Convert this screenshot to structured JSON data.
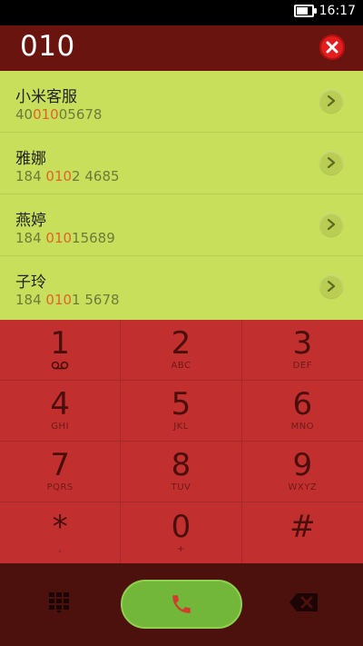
{
  "status_bar": {
    "time": "16:17",
    "battery_level": 0.85,
    "battery_icon": "battery-icon"
  },
  "header": {
    "number": "010",
    "clear_icon": "close-icon",
    "colors": {
      "bg": "#6a1410",
      "clear": "#e21e1e"
    }
  },
  "results": [
    {
      "name": "小米客服",
      "phone_pre": "40",
      "phone_match": "010",
      "phone_post": "05678"
    },
    {
      "name": "雅娜",
      "phone_pre": "184 ",
      "phone_match": "010",
      "phone_post": "2 4685"
    },
    {
      "name": "燕婷",
      "phone_pre": "184 ",
      "phone_match": "010",
      "phone_post": "15689"
    },
    {
      "name": "子玲",
      "phone_pre": "184 ",
      "phone_match": "010",
      "phone_post": "1 5678"
    }
  ],
  "keypad": [
    {
      "digit": "1",
      "letters": "",
      "icon": "voicemail-icon"
    },
    {
      "digit": "2",
      "letters": "ABC"
    },
    {
      "digit": "3",
      "letters": "DEF"
    },
    {
      "digit": "4",
      "letters": "GHI"
    },
    {
      "digit": "5",
      "letters": "JKL"
    },
    {
      "digit": "6",
      "letters": "MNO"
    },
    {
      "digit": "7",
      "letters": "PQRS"
    },
    {
      "digit": "8",
      "letters": "TUV"
    },
    {
      "digit": "9",
      "letters": "WXYZ"
    },
    {
      "digit": "*",
      "letters": ","
    },
    {
      "digit": "0",
      "letters": "+"
    },
    {
      "digit": "#",
      "letters": ""
    }
  ],
  "bottom_bar": {
    "dialpad_icon": "dialpad-icon",
    "call_icon": "phone-icon",
    "backspace_icon": "backspace-icon"
  },
  "colors": {
    "list_bg": "#c8df5c",
    "match_highlight": "#e0632a",
    "keypad_bg": "#c1302e",
    "call_green": "#72b63a"
  }
}
